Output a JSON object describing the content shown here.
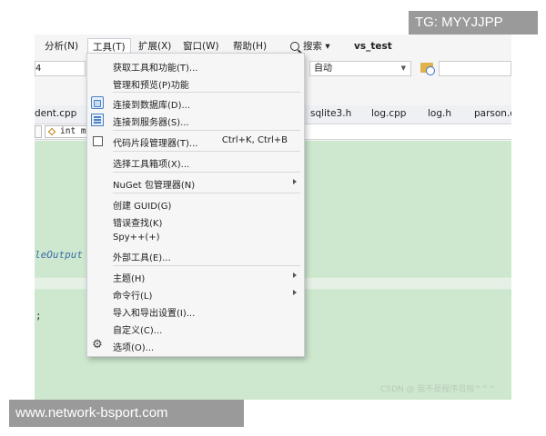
{
  "menubar": {
    "analyze": "分析(N)",
    "tools": "工具(T)",
    "extensions": "扩展(X)",
    "window": "窗口(W)",
    "help": "帮助(H)",
    "search": "搜索 ▾",
    "solution": "vs_test"
  },
  "toolbar": {
    "combo_left_value": "4",
    "config_value": "自动"
  },
  "tabs": [
    "dent.cpp",
    "sqlite3.h",
    "log.cpp",
    "log.h",
    "parson.c"
  ],
  "navbar": {
    "member": "int ma"
  },
  "editor": {
    "fragment": "leOutput",
    "semicolon": ";",
    "watermark": "CSDN @  我不是程序员啦^^^"
  },
  "menu": {
    "items": [
      {
        "label": "获取工具和功能(T)...",
        "icon": ""
      },
      {
        "label": "管理和预览(P)功能",
        "icon": ""
      },
      {
        "label": "连接到数据库(D)...",
        "icon": "database-icon"
      },
      {
        "label": "连接到服务器(S)...",
        "icon": "server-icon"
      },
      {
        "label": "代码片段管理器(T)...",
        "icon": "snippet-icon",
        "shortcut": "Ctrl+K, Ctrl+B"
      },
      {
        "label": "选择工具箱项(X)...",
        "icon": ""
      },
      {
        "label": "NuGet 包管理器(N)",
        "icon": "",
        "submenu": true
      },
      {
        "label": "创建 GUID(G)",
        "icon": ""
      },
      {
        "label": "错误查找(K)",
        "icon": ""
      },
      {
        "label": "Spy++(+)",
        "icon": ""
      },
      {
        "label": "外部工具(E)...",
        "icon": ""
      },
      {
        "label": "主题(H)",
        "icon": "",
        "submenu": true
      },
      {
        "label": "命令行(L)",
        "icon": "",
        "submenu": true
      },
      {
        "label": "导入和导出设置(I)...",
        "icon": ""
      },
      {
        "label": "自定义(C)...",
        "icon": ""
      },
      {
        "label": "选项(O)...",
        "icon": "gear-icon"
      }
    ]
  },
  "overlays": {
    "tg_label": "TG: MYYJJPP",
    "site_label": "www.network-bsport.com"
  },
  "colors": {
    "editor_bg": "#cee8cf",
    "menu_bg": "#f6f6f6",
    "overlay_bg": "#9a9a9a"
  }
}
